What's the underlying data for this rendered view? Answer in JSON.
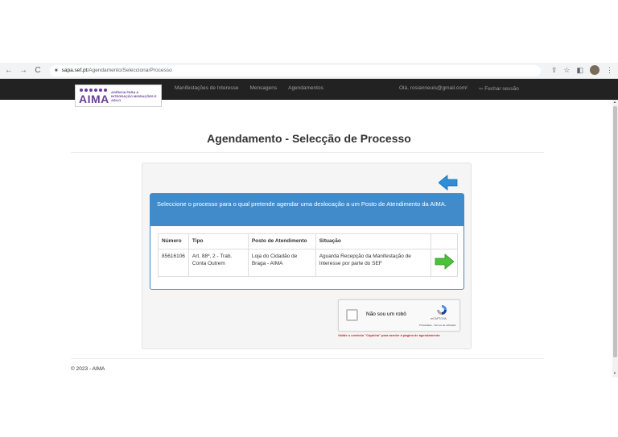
{
  "browser": {
    "back_glyph": "←",
    "forward_glyph": "→",
    "reload_glyph": "C",
    "lock_glyph": "■",
    "url_host": "sapa.sef.pt",
    "url_path": "/Agendamento/SeleccionarProcesso",
    "share_glyph": "⇪",
    "star_glyph": "☆",
    "sidebar_glyph": "◧",
    "menu_glyph": "⋮"
  },
  "logo": {
    "word": "AIMA",
    "tagline": "AGÊNCIA PARA A INTEGRAÇÃO MIGRAÇÕES E ASILO",
    "color": "#6a3f98"
  },
  "nav": {
    "items": [
      "Manifestações de Interesse",
      "Mensagens",
      "Agendamentos"
    ],
    "greeting": "Olá, rosianneuis@gmail.com!",
    "logout_icon": "⇦",
    "logout": "Fechar sessão"
  },
  "page": {
    "title": "Agendamento - Selecção de Processo"
  },
  "panel": {
    "heading": "Seleccione o processo para o qual pretende agendar uma deslocação a um Posto de Atendimento da AIMA.",
    "heading_color": "#428bca"
  },
  "table": {
    "headers": [
      "Número",
      "Tipo",
      "Posto de Atendimento",
      "Situação"
    ],
    "rows": [
      {
        "numero": "85616106",
        "tipo": "Art. 88º, 2 - Trab. Conta Outrem",
        "posto": "Loja do Cidadão de Braga - AIMA",
        "situacao": "Aguarda Recepção da Manifestação de Interesse por parte do SEF"
      }
    ]
  },
  "captcha": {
    "label": "Não sou um robô",
    "brand": "reCAPTCHA",
    "links": "Privacidade - Termos de utilização",
    "warning": "Valide o controlo \"Captcha\" para aceder à página de agendamento"
  },
  "footer": {
    "text": "© 2023 - AIMA"
  },
  "colors": {
    "header_bg": "#222222",
    "arrow_blue": "#2e8fd6",
    "arrow_green": "#4cc23a",
    "warning": "#cc2222"
  }
}
